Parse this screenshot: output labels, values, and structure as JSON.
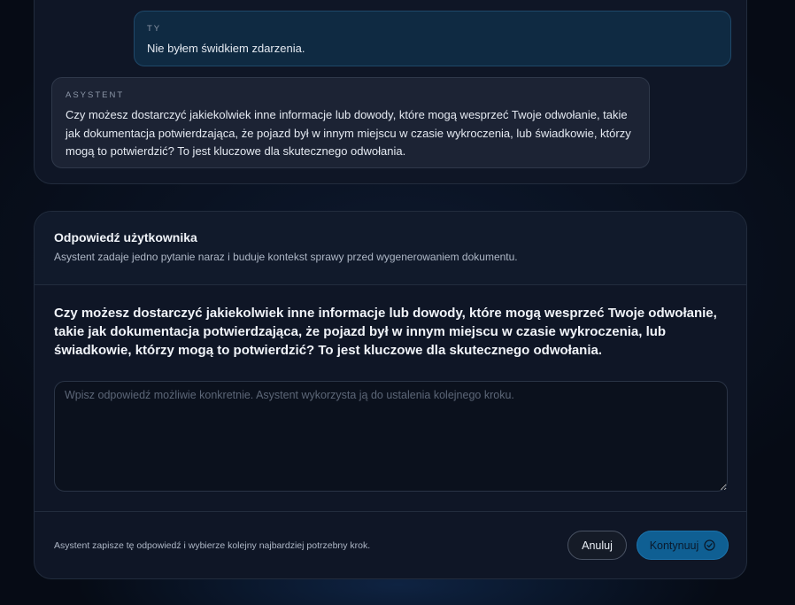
{
  "chat": {
    "user_message": {
      "role": "TY",
      "text": "Nie byłem świdkiem zdarzenia."
    },
    "assistant_message": {
      "role": "ASYSTENT",
      "text": "Czy możesz dostarczyć jakiekolwiek inne informacje lub dowody, które mogą wesprzeć Twoje odwołanie, takie jak dokumentacja potwierdzająca, że pojazd był w innym miejscu w czasie wykroczenia, lub świadkowie, którzy mogą to potwierdzić? To jest kluczowe dla skutecznego odwołania."
    }
  },
  "answer_panel": {
    "title": "Odpowiedź użytkownika",
    "subtitle": "Asystent zadaje jedno pytanie naraz i buduje kontekst sprawy przed wygenerowaniem dokumentu.",
    "question": "Czy możesz dostarczyć jakiekolwiek inne informacje lub dowody, które mogą wesprzeć Twoje odwołanie, takie jak dokumentacja potwierdzająca, że pojazd był w innym miejscu w czasie wykroczenia, lub świadkowie, którzy mogą to potwierdzić? To jest kluczowe dla skutecznego odwołania.",
    "input_value": "",
    "input_placeholder": "Wpisz odpowiedź możliwie konkretnie. Asystent wykorzysta ją do ustalenia kolejnego kroku.",
    "footer_note": "Asystent zapisze tę odpowiedź i wybierze kolejny najbardziej potrzebny krok.",
    "cancel_label": "Anuluj",
    "continue_label": "Kontynuuj",
    "continue_icon": "check-circle-icon"
  },
  "colors": {
    "accent": "#0f5f93",
    "background": "#060b15",
    "card": "#0f1626",
    "user_bubble": "#0f2a42",
    "assistant_bubble": "#1c2334"
  }
}
